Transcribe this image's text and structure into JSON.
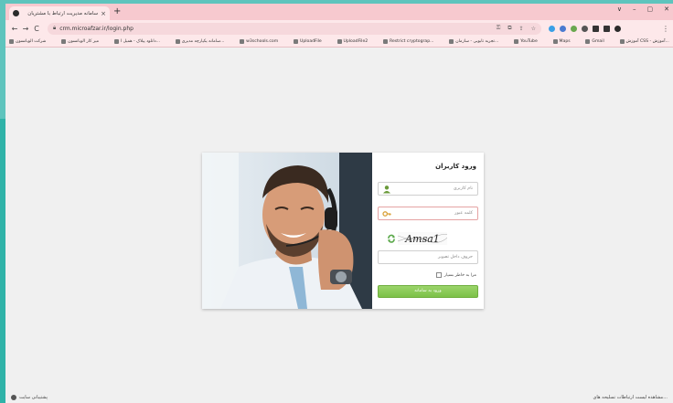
{
  "browser": {
    "tab_title": "سامانه مدیریت ارتباط با مشتریان",
    "tab_close": "×",
    "new_tab": "+",
    "window_controls": [
      "∨",
      "–",
      "▢",
      "✕"
    ],
    "url": "crm.microafzar.ir/login.php",
    "nav": {
      "back": "←",
      "forward": "→",
      "reload": "C"
    },
    "bookmarks_left": [
      {
        "label": "شرکت الوبانسون",
        "icon": "bookmark-icon"
      },
      {
        "label": "میز کار الوبانسون",
        "icon": "bookmark-icon"
      },
      {
        "label": "دانلود پیلاک - همیل ا...",
        "icon": "bookmark-icon"
      },
      {
        "label": "سامانه یکپارچه مدیری...",
        "icon": "bookmark-icon"
      },
      {
        "label": "w3schools.com",
        "icon": "w3-icon"
      },
      {
        "label": "UploadFile",
        "icon": "upload-icon"
      },
      {
        "label": "UploadFile2",
        "icon": "upload-icon"
      },
      {
        "label": "Restrict cryptograp...",
        "icon": "bookmark-icon"
      },
      {
        "label": "تجربه تابوبی - سازمان...",
        "icon": "bookmark-icon"
      },
      {
        "label": "YouTube",
        "icon": "youtube-icon"
      },
      {
        "label": "Maps",
        "icon": "maps-icon"
      },
      {
        "label": "Gmail",
        "icon": "gmail-icon"
      },
      {
        "label": "آموزش CSS - آموزش...",
        "icon": "bookmark-icon"
      }
    ]
  },
  "login": {
    "title": "ورود کاربران",
    "username_placeholder": "نام کاربری",
    "password_placeholder": "کلمه عبور",
    "captcha_text": "Amsa1",
    "captcha_placeholder": "حروف داخل تصویر",
    "remember_label": "مرا به خاطر بسپار",
    "submit_label": "ورود به سامانه"
  },
  "status": {
    "left": "پشتیبانی سایت",
    "right": "مشاهده لیست ارتباطات تسلیحه های..."
  },
  "colors": {
    "accent": "#7cc148",
    "tab_bg": "#f7c9cf",
    "desktop": "#5ec4bd"
  }
}
